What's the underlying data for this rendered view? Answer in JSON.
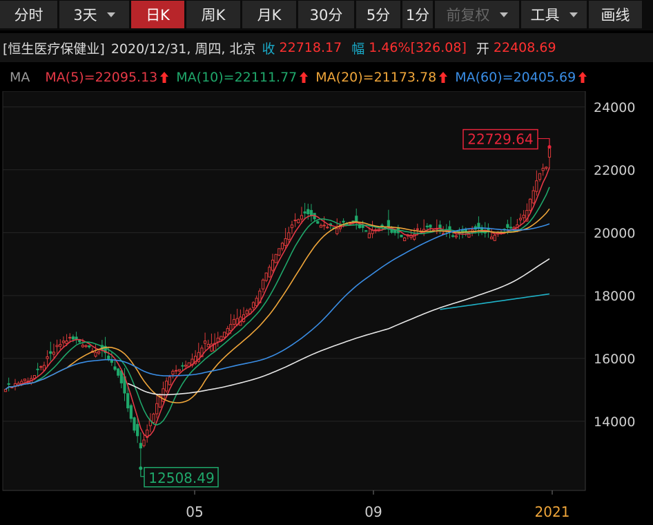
{
  "toolbar": {
    "tabs": [
      {
        "label": "分时",
        "active": false,
        "dropdown": false
      },
      {
        "label": "3天",
        "active": false,
        "dropdown": true
      },
      {
        "label": "日K",
        "active": true,
        "dropdown": false
      },
      {
        "label": "周K",
        "active": false,
        "dropdown": false
      },
      {
        "label": "月K",
        "active": false,
        "dropdown": false
      },
      {
        "label": "30分",
        "active": false,
        "dropdown": false
      },
      {
        "label": "5分",
        "active": false,
        "dropdown": false
      },
      {
        "label": "1分",
        "active": false,
        "dropdown": false
      },
      {
        "label": "前复权",
        "active": false,
        "dropdown": true
      },
      {
        "label": "工具",
        "active": false,
        "dropdown": true
      },
      {
        "label": "画线",
        "active": false,
        "dropdown": false
      }
    ]
  },
  "info": {
    "name": "[恒生医疗保健业]",
    "datetime": "2020/12/31, 周四, 北京",
    "close_label": "收",
    "close_value": "22718.17",
    "change_label": "幅",
    "change_pct": "1.46%",
    "change_abs": "[326.08]",
    "open_label": "开",
    "open_value": "22408.69"
  },
  "ma_legend": {
    "label": "MA",
    "items": [
      {
        "text": "MA(5)=22095.13",
        "color": "#e63946"
      },
      {
        "text": "MA(10)=22111.77",
        "color": "#1fa86b"
      },
      {
        "text": "MA(20)=21173.78",
        "color": "#f0a63a"
      },
      {
        "text": "MA(60)=20405.69",
        "color": "#3a8ee6"
      }
    ],
    "arrow_color": "#ff2b2b"
  },
  "chart_data": {
    "type": "candlestick",
    "title": "",
    "y_ticks": [
      24000,
      22000,
      20000,
      18000,
      16000,
      14000
    ],
    "x_ticks": [
      "05",
      "09",
      "2021"
    ],
    "ylim": [
      11800,
      24500
    ],
    "grid": true,
    "colors": {
      "up": "#e23b3b",
      "down": "#1fa86b",
      "ma5": "#e63946",
      "ma10": "#1fa86b",
      "ma20": "#f0a63a",
      "ma60": "#3a8ee6",
      "ma120": "#e8e8e8",
      "ma250": "#1fb3c9"
    },
    "max_marker": {
      "value": "22729.64",
      "color": "#e8243b"
    },
    "min_marker": {
      "value": "12508.49",
      "color": "#1fa86b"
    },
    "close_series": [
      15050,
      15090,
      15120,
      15180,
      15220,
      15270,
      15330,
      15320,
      15380,
      15450,
      15560,
      15700,
      15820,
      15950,
      16080,
      16200,
      16330,
      16450,
      16520,
      16580,
      16620,
      16600,
      16580,
      16530,
      16480,
      16420,
      16360,
      16300,
      16250,
      16220,
      16180,
      16120,
      16020,
      15880,
      15700,
      15450,
      15150,
      14800,
      14420,
      14050,
      13700,
      13450,
      13350,
      13450,
      13680,
      13950,
      14250,
      14550,
      14850,
      15100,
      15300,
      15450,
      15550,
      15600,
      15650,
      15700,
      15780,
      15880,
      16000,
      16120,
      16250,
      16380,
      16480,
      16520,
      16540,
      16560,
      16620,
      16720,
      16840,
      16970,
      17100,
      17230,
      17330,
      17400,
      17440,
      17500,
      17600,
      17750,
      17950,
      18200,
      18460,
      18720,
      18950,
      19160,
      19340,
      19500,
      19660,
      19830,
      20000,
      20170,
      20330,
      20450,
      20530,
      20560,
      20540,
      20480,
      20400,
      20330,
      20280,
      20230,
      20200,
      20180,
      20170,
      20190,
      20230,
      20270,
      20300,
      20320,
      20300,
      20250,
      20190,
      20130,
      20080,
      20050,
      20060,
      20090,
      20120,
      20140,
      20130,
      20090,
      20030,
      19970,
      19920,
      19890,
      19880,
      19900,
      19940,
      19990,
      20040,
      20080,
      20110,
      20130,
      20140,
      20130,
      20100,
      20070,
      20030,
      19990,
      19950,
      19920,
      19900,
      19910,
      19940,
      19980,
      20020,
      20050,
      20060,
      20040,
      20010,
      19980,
      19960,
      19950,
      19960,
      19980,
      20010,
      20040,
      20080,
      20130,
      20190,
      20270,
      20380,
      20540,
      20780,
      21060,
      21380,
      21650,
      21860,
      22000,
      22080,
      22110
    ]
  }
}
